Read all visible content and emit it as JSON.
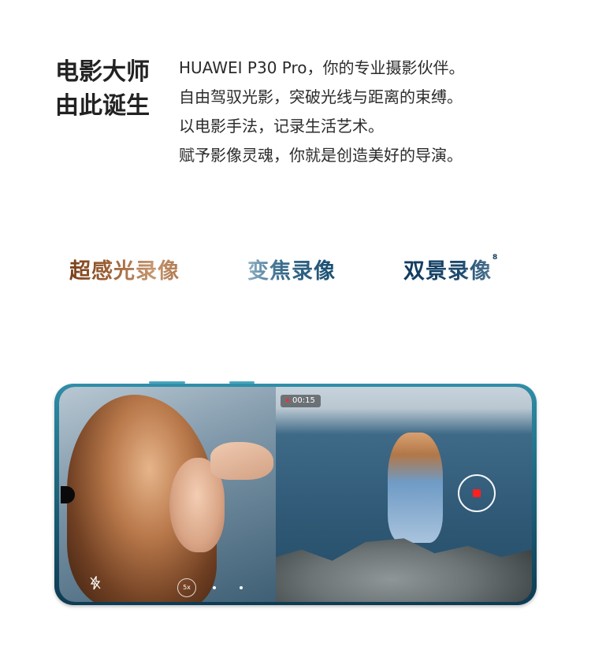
{
  "headline": [
    "电影大师",
    "由此诞生"
  ],
  "description": [
    "HUAWEI P30 Pro，你的专业摄影伙伴。",
    "自由驾驭光影，突破光线与距离的束缚。",
    "以电影手法，记录生活艺术。",
    "赋予影像灵魂，你就是创造美好的导演。"
  ],
  "modes": [
    {
      "label": "超感光录像"
    },
    {
      "label": "变焦录像"
    },
    {
      "label": "双景录像",
      "footnote": "8"
    }
  ],
  "camera_ui": {
    "timer": "00:15",
    "zoom": "5x"
  },
  "colors": {
    "phone_frame": "#1f6b83",
    "record_stop": "#ff1f1f"
  }
}
